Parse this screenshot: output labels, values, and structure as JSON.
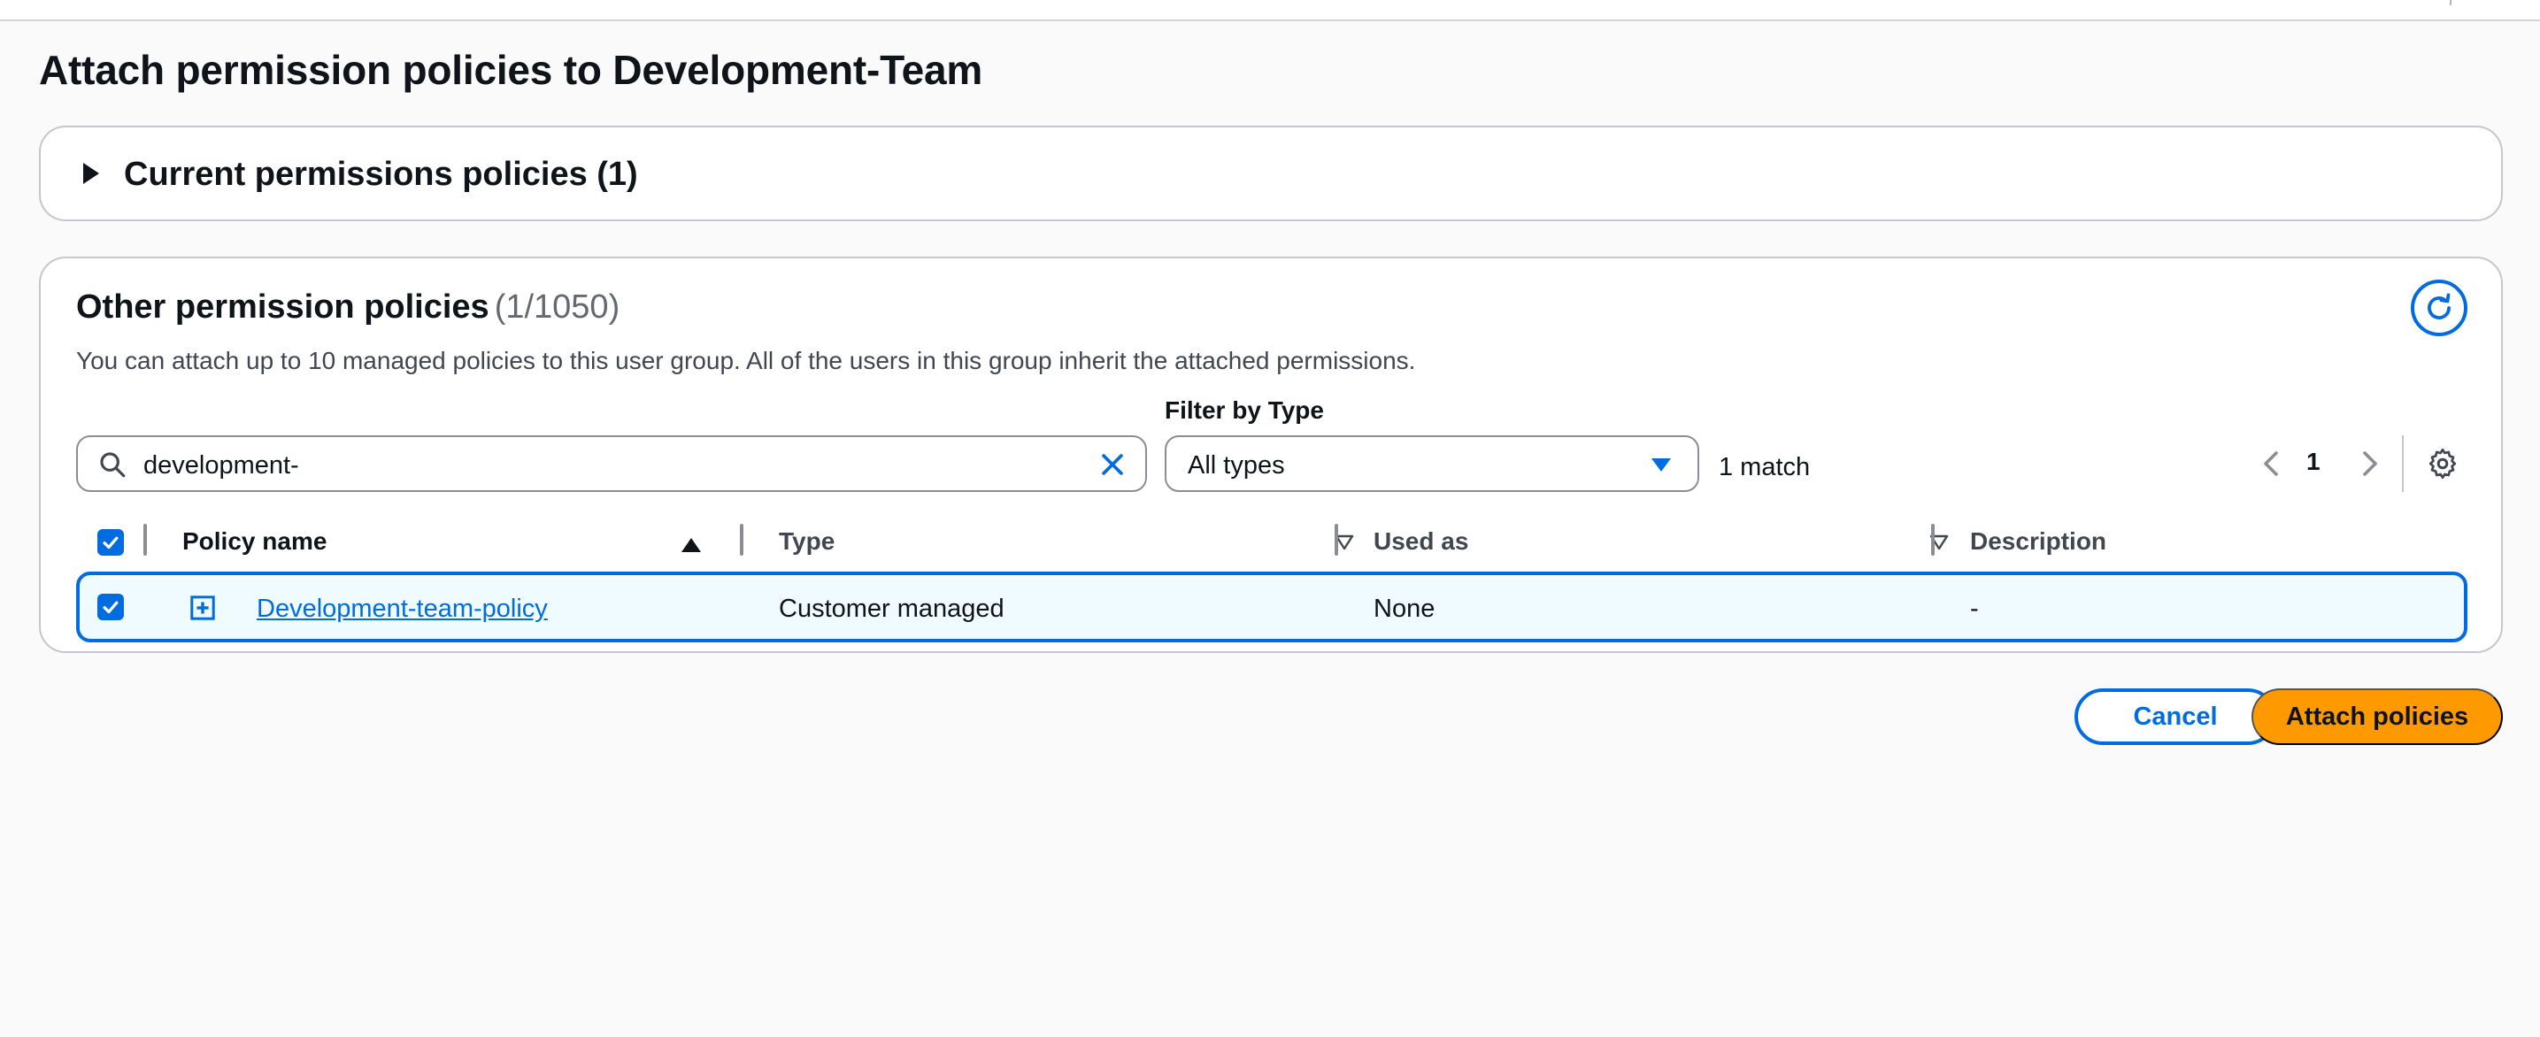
{
  "page": {
    "title": "Attach permission policies to Development-Team"
  },
  "current_panel": {
    "title": "Current permissions policies (1)",
    "expand_icon": "caret-right-icon"
  },
  "other_panel": {
    "title": "Other permission policies",
    "count": "(1/1050)",
    "description": "You can attach up to 10 managed policies to this user group. All of the users in this group inherit the attached permissions.",
    "refresh_icon": "refresh-icon"
  },
  "filters": {
    "search_value": "development-",
    "filter_label": "Filter by Type",
    "type_selected": "All types",
    "match_count": "1 match"
  },
  "pagination": {
    "current_page": "1"
  },
  "table": {
    "columns": [
      "Policy name",
      "Type",
      "Used as",
      "Description"
    ],
    "rows": [
      {
        "selected": true,
        "policy_name": "Development-team-policy",
        "type": "Customer managed",
        "used_as": "None",
        "description": "-"
      }
    ]
  },
  "actions": {
    "cancel_label": "Cancel",
    "attach_label": "Attach policies"
  },
  "colors": {
    "accent": "#006ce0",
    "primary_button": "#ff9900",
    "row_selected_bg": "#f0fbff"
  }
}
